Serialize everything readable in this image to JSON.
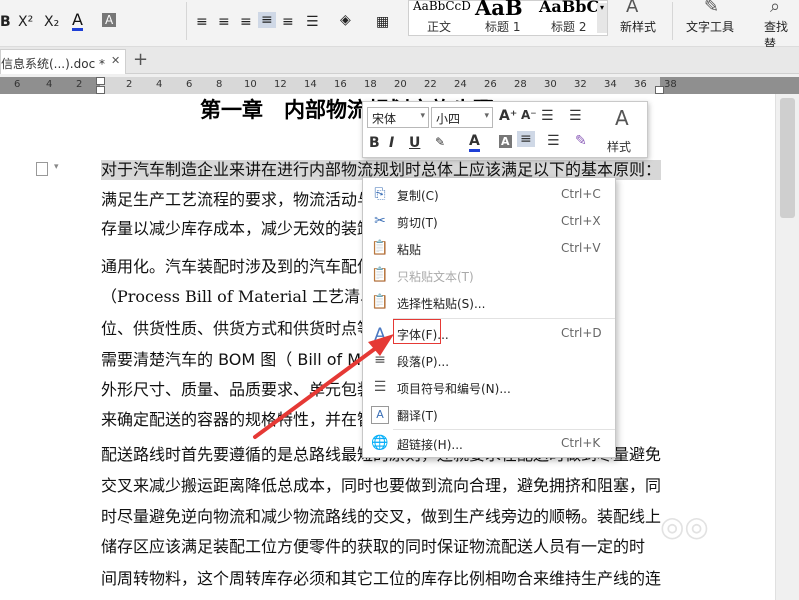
{
  "ribbon": {
    "font_buttons": [
      "B",
      "X²",
      "X₂",
      "A"
    ],
    "styles": [
      {
        "preview": "AaBbCcD",
        "name": "正文"
      },
      {
        "preview": "AaB",
        "name": "标题 1"
      },
      {
        "preview": "AaBbC",
        "name": "标题 2"
      }
    ],
    "new_style": "新样式",
    "text_tools": "文字工具",
    "find_replace": "查找替"
  },
  "tab": {
    "label": "信息系统(...).doc *",
    "close": "✕",
    "add": "+"
  },
  "ruler": {
    "numbers": [
      "6",
      "4",
      "2",
      "2",
      "4",
      "6",
      "8",
      "10",
      "12",
      "14",
      "16",
      "18",
      "20",
      "22",
      "24",
      "26",
      "28",
      "30",
      "32",
      "34",
      "36",
      "38"
    ]
  },
  "document": {
    "heading": "第一章　内部物流规划实施步骤",
    "lines": [
      "对于汽车制造企业来讲在进行内部物流规划时总体上应该满足以下的基本原则：",
      "满足生产工艺流程的要求，物流活动与生产工艺流程相配合，合理的库",
      "存量以减少库存成本，减少无效的装卸与搬运，尽可能实现标准化，",
      "通用化。汽车装配时涉及到的汽车配件种类繁多，需要借助 BOM 图",
      "（Process Bill of Material  工艺清单）来确定零件的装配位置、使用工",
      "位、供货性质、供货方式和供货时点等信息，由于零件种类繁多，",
      "需要清楚汽车的 BOM 图（  Bill of Material）来确定零件的形状、",
      "外形尺寸、质量、品质要求、单元包装数量等，根据零件外形尺寸",
      "来确定配送的容器的规格特性，并在智能化的基础上设计生产线的",
      "配送路线时首先要遵循的是总路线最短的原则，还就要求在配送时做到尽量避免",
      "交叉来减少搬运距离降低总成本，同时也要做到流向合理，避免拥挤和阻塞，同",
      "时尽量避免逆向物流和减少物流路线的交叉，做到生产线旁边的顺畅。装配线上",
      "储存区应该满足装配工位方便零件的获取的同时保证物流配送人员有一定的时",
      "间周转物料，这个周转库存必须和其它工位的库存比例相吻合来维持生产线的连"
    ]
  },
  "minibar": {
    "font_name": "宋体",
    "font_size": "小四",
    "styles_label": "样式",
    "buttons": [
      "B",
      "I",
      "U",
      "A",
      "A"
    ]
  },
  "context_menu": {
    "items": [
      {
        "label": "复制(C)",
        "shortcut": "Ctrl+C",
        "icon": "copy-icon",
        "glyph": "⎘",
        "disabled": false
      },
      {
        "label": "剪切(T)",
        "shortcut": "Ctrl+X",
        "icon": "scissors-icon",
        "glyph": "✂",
        "disabled": false
      },
      {
        "label": "粘贴",
        "shortcut": "Ctrl+V",
        "icon": "paste-icon",
        "glyph": "📋",
        "disabled": false
      },
      {
        "label": "只粘贴文本(T)",
        "shortcut": "",
        "icon": "paste-text-icon",
        "glyph": "📋",
        "disabled": true
      },
      {
        "label": "选择性粘贴(S)...",
        "shortcut": "",
        "icon": "paste-special-icon",
        "glyph": "📋",
        "disabled": false
      },
      {
        "label": "字体(F)...",
        "shortcut": "Ctrl+D",
        "icon": "font-icon",
        "glyph": "A",
        "disabled": false
      },
      {
        "label": "段落(P)...",
        "shortcut": "",
        "icon": "paragraph-icon",
        "glyph": "≡",
        "disabled": false
      },
      {
        "label": "项目符号和编号(N)...",
        "shortcut": "",
        "icon": "bullets-icon",
        "glyph": "☰",
        "disabled": false
      },
      {
        "label": "翻译(T)",
        "shortcut": "",
        "icon": "translate-icon",
        "glyph": "A",
        "disabled": false
      },
      {
        "label": "超链接(H)...",
        "shortcut": "Ctrl+K",
        "icon": "hyperlink-icon",
        "glyph": "🌐",
        "disabled": false
      }
    ]
  },
  "colors": {
    "accent": "#2e5fa8",
    "highlight": "#e53935",
    "selection": "#d7d7d7"
  }
}
